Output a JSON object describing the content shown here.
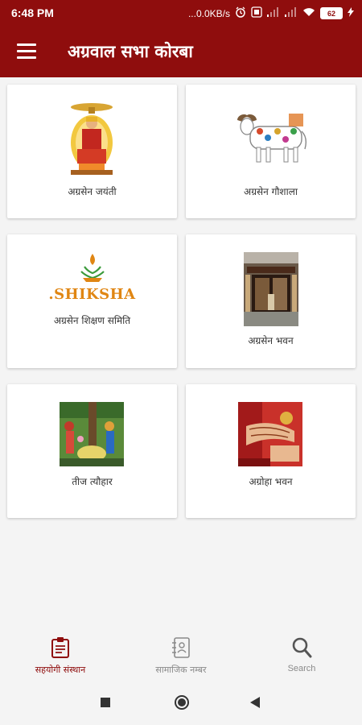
{
  "status": {
    "time": "6:48 PM",
    "network": "...0.0KB/s",
    "battery": "62"
  },
  "appbar": {
    "title": "अग्रवाल सभा कोरबा"
  },
  "cards": [
    {
      "label": "अग्रसेन जयंती",
      "icon": "agrasen-portrait"
    },
    {
      "label": "अग्रसेन गौशाला",
      "icon": "cow-illustration"
    },
    {
      "label": "अग्रसेन शिक्षण समिति",
      "icon": "shiksha-logo",
      "logo_text": ".SHIKSHA"
    },
    {
      "label": "अग्रसेन भवन",
      "icon": "building-doorway"
    },
    {
      "label": "तीज त्यौहार",
      "icon": "festival-image"
    },
    {
      "label": "अग्रोहा भवन",
      "icon": "wedding-hands-image"
    }
  ],
  "bottom_nav": [
    {
      "label": "सहयोगी संस्थान",
      "icon": "clipboard-icon",
      "active": true
    },
    {
      "label": "सामाजिक नम्बर",
      "icon": "contact-book-icon",
      "active": false
    },
    {
      "label": "Search",
      "icon": "search-icon",
      "active": false
    }
  ],
  "colors": {
    "primary": "#8f0d0d",
    "active_tab": "#8f0d0d",
    "inactive_tab": "#8a8a8a",
    "shiksha_orange": "#e08613"
  }
}
